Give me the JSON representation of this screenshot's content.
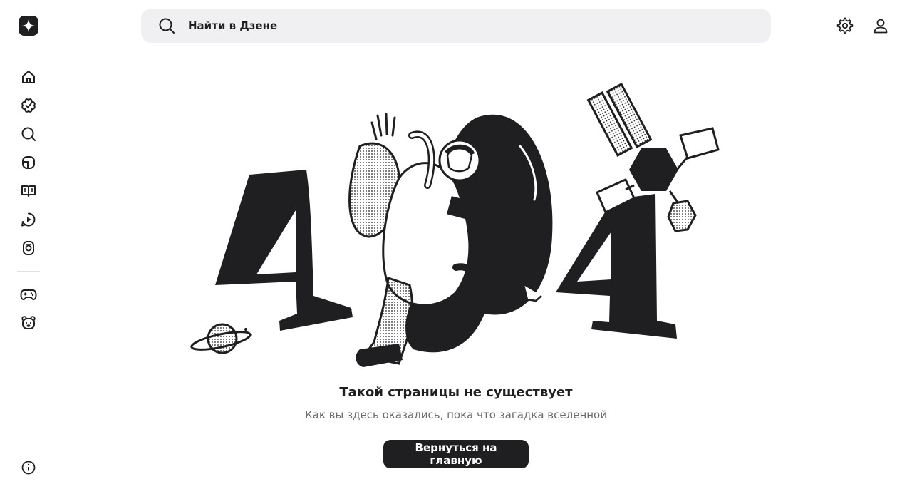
{
  "header": {
    "search_placeholder": "Найти в Дзене"
  },
  "sidebar": {
    "items": [
      {
        "icon": "home-icon"
      },
      {
        "icon": "subscriptions-icon"
      },
      {
        "icon": "search-icon"
      },
      {
        "icon": "articles-icon"
      },
      {
        "icon": "book-icon"
      },
      {
        "icon": "video-icon"
      },
      {
        "icon": "shorts-icon"
      },
      {
        "icon": "games-icon"
      },
      {
        "icon": "kids-icon"
      }
    ]
  },
  "error": {
    "illustration": "404",
    "title": "Такой страницы не существует",
    "subtitle": "Как вы здесь оказались, пока что загадка вселенной",
    "button_label": "Вернуться на главную"
  },
  "colors": {
    "accent": "#1f1f22",
    "search_bg": "#f0f0f2",
    "subtitle_text": "#6b6b70"
  }
}
